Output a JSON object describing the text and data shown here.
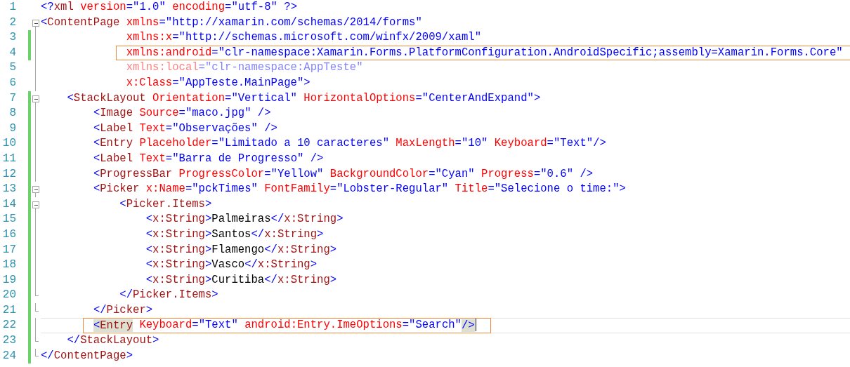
{
  "editor": {
    "lines": [
      {
        "number": "1",
        "changed": false,
        "collapsible": false,
        "fold_end": false,
        "tokens": [
          {
            "kind": "punct",
            "text": "<?"
          },
          {
            "kind": "tag",
            "text": "xml"
          },
          {
            "kind": "attr",
            "text": " version"
          },
          {
            "kind": "punct",
            "text": "="
          },
          {
            "kind": "value",
            "text": "\"1.0\""
          },
          {
            "kind": "attr",
            "text": " encoding"
          },
          {
            "kind": "punct",
            "text": "="
          },
          {
            "kind": "value",
            "text": "\"utf-8\""
          },
          {
            "kind": "punct",
            "text": " ?>"
          }
        ]
      },
      {
        "number": "2",
        "changed": false,
        "collapsible": true,
        "fold_end": false,
        "tokens": [
          {
            "kind": "punct",
            "text": "<"
          },
          {
            "kind": "tag",
            "text": "ContentPage"
          },
          {
            "kind": "attr",
            "text": " xmlns"
          },
          {
            "kind": "punct",
            "text": "="
          },
          {
            "kind": "value",
            "text": "\"http://xamarin.com/schemas/2014/forms\""
          }
        ]
      },
      {
        "number": "3",
        "changed": true,
        "collapsible": false,
        "fold_end": false,
        "tokens": [
          {
            "kind": "attr",
            "text": "             xmlns:x"
          },
          {
            "kind": "punct",
            "text": "="
          },
          {
            "kind": "value",
            "text": "\"http://schemas.microsoft.com/winfx/2009/xaml\""
          }
        ]
      },
      {
        "number": "4",
        "changed": true,
        "collapsible": false,
        "fold_end": false,
        "boxed": true,
        "tokens": [
          {
            "kind": "attr",
            "text": "             xmlns:android"
          },
          {
            "kind": "punct",
            "text": "="
          },
          {
            "kind": "value",
            "text": "\"clr-namespace:Xamarin.Forms.PlatformConfiguration.AndroidSpecific;assembly=Xamarin.Forms.Core\""
          }
        ]
      },
      {
        "number": "5",
        "changed": false,
        "collapsible": false,
        "fold_end": false,
        "faded": true,
        "tokens": [
          {
            "kind": "attr",
            "text": "             xmlns:local"
          },
          {
            "kind": "punct",
            "text": "="
          },
          {
            "kind": "value",
            "text": "\"clr-namespace:AppTeste\""
          }
        ]
      },
      {
        "number": "6",
        "changed": false,
        "collapsible": false,
        "fold_end": false,
        "tokens": [
          {
            "kind": "attr",
            "text": "             x:Class"
          },
          {
            "kind": "punct",
            "text": "="
          },
          {
            "kind": "value",
            "text": "\"AppTeste.MainPage\""
          },
          {
            "kind": "punct",
            "text": ">"
          }
        ]
      },
      {
        "number": "7",
        "changed": true,
        "collapsible": true,
        "fold_end": false,
        "tokens": [
          {
            "kind": "punct",
            "text": "\t<"
          },
          {
            "kind": "tag",
            "text": "StackLayout"
          },
          {
            "kind": "attr",
            "text": " Orientation"
          },
          {
            "kind": "punct",
            "text": "="
          },
          {
            "kind": "value",
            "text": "\"Vertical\""
          },
          {
            "kind": "attr",
            "text": " HorizontalOptions"
          },
          {
            "kind": "punct",
            "text": "="
          },
          {
            "kind": "value",
            "text": "\"CenterAndExpand\""
          },
          {
            "kind": "punct",
            "text": ">"
          }
        ]
      },
      {
        "number": "8",
        "changed": true,
        "collapsible": false,
        "fold_end": false,
        "tokens": [
          {
            "kind": "punct",
            "text": "\t\t<"
          },
          {
            "kind": "tag",
            "text": "Image"
          },
          {
            "kind": "attr",
            "text": " Source"
          },
          {
            "kind": "punct",
            "text": "="
          },
          {
            "kind": "value",
            "text": "\"maco.jpg\""
          },
          {
            "kind": "punct",
            "text": " />"
          }
        ]
      },
      {
        "number": "9",
        "changed": true,
        "collapsible": false,
        "fold_end": false,
        "tokens": [
          {
            "kind": "punct",
            "text": "\t\t<"
          },
          {
            "kind": "tag",
            "text": "Label"
          },
          {
            "kind": "attr",
            "text": " Text"
          },
          {
            "kind": "punct",
            "text": "="
          },
          {
            "kind": "value",
            "text": "\"Observações\""
          },
          {
            "kind": "punct",
            "text": " />"
          }
        ]
      },
      {
        "number": "10",
        "changed": true,
        "collapsible": false,
        "fold_end": false,
        "tokens": [
          {
            "kind": "punct",
            "text": "\t\t<"
          },
          {
            "kind": "tag",
            "text": "Entry"
          },
          {
            "kind": "attr",
            "text": " Placeholder"
          },
          {
            "kind": "punct",
            "text": "="
          },
          {
            "kind": "value",
            "text": "\"Limitado a 10 caracteres\""
          },
          {
            "kind": "attr",
            "text": " MaxLength"
          },
          {
            "kind": "punct",
            "text": "="
          },
          {
            "kind": "value",
            "text": "\"10\""
          },
          {
            "kind": "attr",
            "text": " Keyboard"
          },
          {
            "kind": "punct",
            "text": "="
          },
          {
            "kind": "value",
            "text": "\"Text\""
          },
          {
            "kind": "punct",
            "text": "/>"
          }
        ]
      },
      {
        "number": "11",
        "changed": true,
        "collapsible": false,
        "fold_end": false,
        "tokens": [
          {
            "kind": "punct",
            "text": "\t\t<"
          },
          {
            "kind": "tag",
            "text": "Label"
          },
          {
            "kind": "attr",
            "text": " Text"
          },
          {
            "kind": "punct",
            "text": "="
          },
          {
            "kind": "value",
            "text": "\"Barra de Progresso\""
          },
          {
            "kind": "punct",
            "text": " />"
          }
        ]
      },
      {
        "number": "12",
        "changed": true,
        "collapsible": false,
        "fold_end": false,
        "tokens": [
          {
            "kind": "punct",
            "text": "\t\t<"
          },
          {
            "kind": "tag",
            "text": "ProgressBar"
          },
          {
            "kind": "attr",
            "text": " ProgressColor"
          },
          {
            "kind": "punct",
            "text": "="
          },
          {
            "kind": "value",
            "text": "\"Yellow\""
          },
          {
            "kind": "attr",
            "text": " BackgroundColor"
          },
          {
            "kind": "punct",
            "text": "="
          },
          {
            "kind": "value",
            "text": "\"Cyan\""
          },
          {
            "kind": "attr",
            "text": " Progress"
          },
          {
            "kind": "punct",
            "text": "="
          },
          {
            "kind": "value",
            "text": "\"0.6\""
          },
          {
            "kind": "punct",
            "text": " />"
          }
        ]
      },
      {
        "number": "13",
        "changed": true,
        "collapsible": true,
        "fold_end": false,
        "tokens": [
          {
            "kind": "punct",
            "text": "\t\t<"
          },
          {
            "kind": "tag",
            "text": "Picker"
          },
          {
            "kind": "attr",
            "text": " x:Name"
          },
          {
            "kind": "punct",
            "text": "="
          },
          {
            "kind": "value",
            "text": "\"pckTimes\""
          },
          {
            "kind": "attr",
            "text": " FontFamily"
          },
          {
            "kind": "punct",
            "text": "="
          },
          {
            "kind": "value",
            "text": "\"Lobster-Regular\""
          },
          {
            "kind": "attr",
            "text": " Title"
          },
          {
            "kind": "punct",
            "text": "="
          },
          {
            "kind": "value",
            "text": "\"Selecione o time:\""
          },
          {
            "kind": "punct",
            "text": ">"
          }
        ]
      },
      {
        "number": "14",
        "changed": true,
        "collapsible": true,
        "fold_end": false,
        "tokens": [
          {
            "kind": "punct",
            "text": "\t\t\t<"
          },
          {
            "kind": "tag",
            "text": "Picker.Items"
          },
          {
            "kind": "punct",
            "text": ">"
          }
        ]
      },
      {
        "number": "15",
        "changed": true,
        "collapsible": false,
        "fold_end": false,
        "tokens": [
          {
            "kind": "punct",
            "text": "\t\t\t\t<"
          },
          {
            "kind": "tag",
            "text": "x:String"
          },
          {
            "kind": "punct",
            "text": ">"
          },
          {
            "kind": "text",
            "text": "Palmeiras"
          },
          {
            "kind": "punct",
            "text": "</"
          },
          {
            "kind": "tag",
            "text": "x:String"
          },
          {
            "kind": "punct",
            "text": ">"
          }
        ]
      },
      {
        "number": "16",
        "changed": true,
        "collapsible": false,
        "fold_end": false,
        "tokens": [
          {
            "kind": "punct",
            "text": "\t\t\t\t<"
          },
          {
            "kind": "tag",
            "text": "x:String"
          },
          {
            "kind": "punct",
            "text": ">"
          },
          {
            "kind": "text",
            "text": "Santos"
          },
          {
            "kind": "punct",
            "text": "</"
          },
          {
            "kind": "tag",
            "text": "x:String"
          },
          {
            "kind": "punct",
            "text": ">"
          }
        ]
      },
      {
        "number": "17",
        "changed": true,
        "collapsible": false,
        "fold_end": false,
        "tokens": [
          {
            "kind": "punct",
            "text": "\t\t\t\t<"
          },
          {
            "kind": "tag",
            "text": "x:String"
          },
          {
            "kind": "punct",
            "text": ">"
          },
          {
            "kind": "text",
            "text": "Flamengo"
          },
          {
            "kind": "punct",
            "text": "</"
          },
          {
            "kind": "tag",
            "text": "x:String"
          },
          {
            "kind": "punct",
            "text": ">"
          }
        ]
      },
      {
        "number": "18",
        "changed": true,
        "collapsible": false,
        "fold_end": false,
        "tokens": [
          {
            "kind": "punct",
            "text": "\t\t\t\t<"
          },
          {
            "kind": "tag",
            "text": "x:String"
          },
          {
            "kind": "punct",
            "text": ">"
          },
          {
            "kind": "text",
            "text": "Vasco"
          },
          {
            "kind": "punct",
            "text": "</"
          },
          {
            "kind": "tag",
            "text": "x:String"
          },
          {
            "kind": "punct",
            "text": ">"
          }
        ]
      },
      {
        "number": "19",
        "changed": true,
        "collapsible": false,
        "fold_end": false,
        "tokens": [
          {
            "kind": "punct",
            "text": "\t\t\t\t<"
          },
          {
            "kind": "tag",
            "text": "x:String"
          },
          {
            "kind": "punct",
            "text": ">"
          },
          {
            "kind": "text",
            "text": "Curitiba"
          },
          {
            "kind": "punct",
            "text": "</"
          },
          {
            "kind": "tag",
            "text": "x:String"
          },
          {
            "kind": "punct",
            "text": ">"
          }
        ]
      },
      {
        "number": "20",
        "changed": true,
        "collapsible": false,
        "fold_end": true,
        "tokens": [
          {
            "kind": "punct",
            "text": "\t\t\t</"
          },
          {
            "kind": "tag",
            "text": "Picker.Items"
          },
          {
            "kind": "punct",
            "text": ">"
          }
        ]
      },
      {
        "number": "21",
        "changed": true,
        "collapsible": false,
        "fold_end": true,
        "tokens": [
          {
            "kind": "punct",
            "text": "\t\t</"
          },
          {
            "kind": "tag",
            "text": "Picker"
          },
          {
            "kind": "punct",
            "text": ">"
          }
        ]
      },
      {
        "number": "22",
        "changed": true,
        "collapsible": false,
        "fold_end": false,
        "boxed": true,
        "current": true,
        "tokens": [
          {
            "kind": "punct",
            "text": "\t\t<",
            "match": true
          },
          {
            "kind": "tag",
            "text": "Entry",
            "match": true
          },
          {
            "kind": "attr",
            "text": " Keyboard"
          },
          {
            "kind": "punct",
            "text": "="
          },
          {
            "kind": "value",
            "text": "\"Text\""
          },
          {
            "kind": "attr",
            "text": " android:Entry.ImeOptions"
          },
          {
            "kind": "punct",
            "text": "="
          },
          {
            "kind": "value",
            "text": "\"Search\""
          },
          {
            "kind": "punct",
            "text": "/>",
            "match": true
          }
        ]
      },
      {
        "number": "23",
        "changed": true,
        "collapsible": false,
        "fold_end": true,
        "tokens": [
          {
            "kind": "punct",
            "text": "\t</"
          },
          {
            "kind": "tag",
            "text": "StackLayout"
          },
          {
            "kind": "punct",
            "text": ">"
          }
        ]
      },
      {
        "number": "24",
        "changed": true,
        "collapsible": false,
        "fold_end": true,
        "tokens": [
          {
            "kind": "punct",
            "text": "</"
          },
          {
            "kind": "tag",
            "text": "ContentPage"
          },
          {
            "kind": "punct",
            "text": ">"
          }
        ]
      }
    ]
  }
}
